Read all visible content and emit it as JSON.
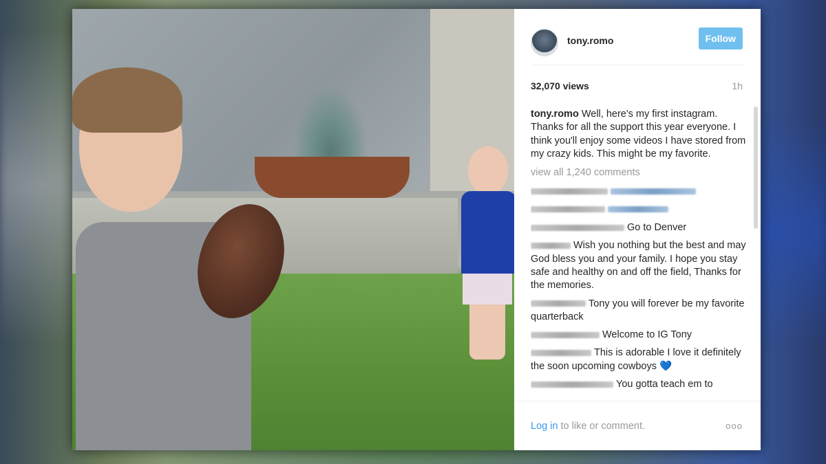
{
  "post": {
    "username": "tony.romo",
    "follow_label": "Follow",
    "views": "32,070 views",
    "time": "1h",
    "caption_user": "tony.romo",
    "caption_text": "Well, here's my first instagram. Thanks for all the support this year everyone. I think you'll enjoy some videos I have stored from my crazy kids. This might be my favorite.",
    "view_all": "view all 1,240 comments"
  },
  "comments": [
    {
      "text": ""
    },
    {
      "text": ""
    },
    {
      "text": "Go to Denver"
    },
    {
      "text": "Wish you nothing but the best and may God bless you and your family. I hope you stay safe and healthy on and off the field, Thanks for the memories."
    },
    {
      "text": "Tony you will forever be my favorite quarterback"
    },
    {
      "text": "Welcome to IG Tony"
    },
    {
      "text": "This is adorable I love it definitely the soon upcoming cowboys",
      "emoji": "💙"
    },
    {
      "text": "You gotta teach em to"
    }
  ],
  "footer": {
    "login_label": "Log in",
    "login_rest": "to like or comment.",
    "more_icon": "ooo"
  },
  "colors": {
    "follow_bg": "#70c0ef",
    "link_blue": "#3897f0",
    "muted": "#999999"
  }
}
